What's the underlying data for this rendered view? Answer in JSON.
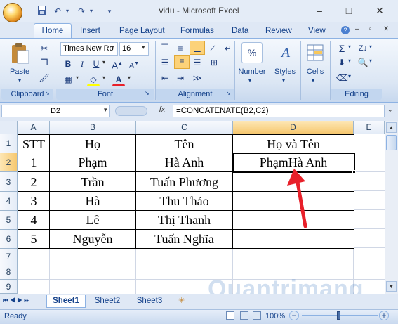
{
  "window": {
    "title": "vidu - Microsoft Excel",
    "minimize": "–",
    "maximize": "□",
    "close": "✕"
  },
  "ribbon_tabs": [
    "Home",
    "Insert",
    "Page Layout",
    "Formulas",
    "Data",
    "Review",
    "View"
  ],
  "ribbon": {
    "clipboard": {
      "paste_label": "Paste",
      "group_label": "Clipboard"
    },
    "font": {
      "font_name": "Times New Ro",
      "font_size": "16",
      "group_label": "Font",
      "bold": "B",
      "italic": "I",
      "underline": "U"
    },
    "alignment": {
      "group_label": "Alignment"
    },
    "number": {
      "label": "Number",
      "symbol": "%"
    },
    "styles": {
      "label": "Styles"
    },
    "cells": {
      "label": "Cells"
    },
    "editing": {
      "group_label": "Editing"
    }
  },
  "formula_bar": {
    "name_box": "D2",
    "fx_label": "fx",
    "formula": "=CONCATENATE(B2,C2)"
  },
  "columns": [
    "A",
    "B",
    "C",
    "D",
    "E"
  ],
  "rows": [
    "1",
    "2",
    "3",
    "4",
    "5",
    "6",
    "7",
    "8",
    "9"
  ],
  "table": {
    "headers": [
      "STT",
      "Họ",
      "Tên",
      "Họ và Tên"
    ],
    "rows": [
      [
        "1",
        "Phạm",
        "Hà Anh",
        "PhạmHà Anh"
      ],
      [
        "2",
        "Trần",
        "Tuấn Phương",
        ""
      ],
      [
        "3",
        "Hà",
        "Thu Thảo",
        ""
      ],
      [
        "4",
        "Lê",
        "Thị Thanh",
        ""
      ],
      [
        "5",
        "Nguyễn",
        "Tuấn Nghĩa",
        ""
      ]
    ]
  },
  "sheets": [
    "Sheet1",
    "Sheet2",
    "Sheet3"
  ],
  "status": {
    "text": "Ready",
    "zoom": "100%"
  },
  "watermark": "Quantrimang",
  "colors": {
    "arrow": "#e8202a",
    "accent": "#15428b",
    "active_col": "#f9d99a"
  }
}
